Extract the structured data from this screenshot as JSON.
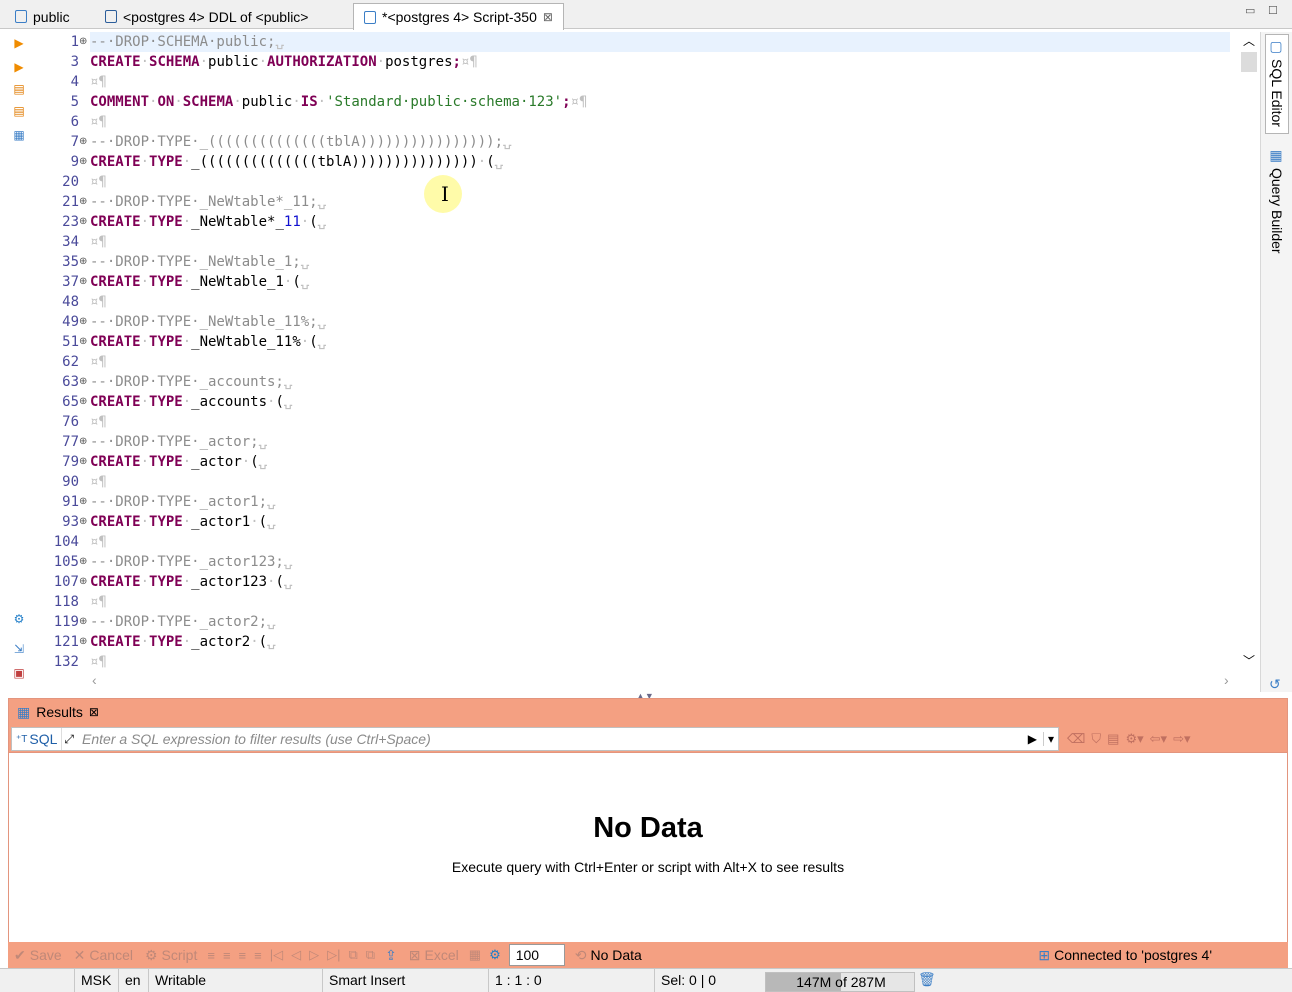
{
  "tabs": [
    {
      "label": "public",
      "icon": "schema-icon",
      "active": false
    },
    {
      "label": "<postgres 4> DDL of <public>",
      "icon": "ddl-icon",
      "active": false
    },
    {
      "label": "*<postgres 4> Script-350",
      "icon": "script-icon",
      "active": true
    }
  ],
  "editor": {
    "lines": [
      {
        "n": "1",
        "fold": "⊕",
        "code": [
          {
            "t": "cm",
            "v": "--·DROP·SCHEMA·public;"
          },
          {
            "t": "ws",
            "v": "⍽"
          }
        ]
      },
      {
        "n": "3",
        "fold": "",
        "code": [
          {
            "t": "kw",
            "v": "CREATE"
          },
          {
            "t": "ws",
            "v": "·"
          },
          {
            "t": "kw",
            "v": "SCHEMA"
          },
          {
            "t": "ws",
            "v": "·"
          },
          {
            "t": "tx",
            "v": "public"
          },
          {
            "t": "ws",
            "v": "·"
          },
          {
            "t": "kw",
            "v": "AUTHORIZATION"
          },
          {
            "t": "ws",
            "v": "·"
          },
          {
            "t": "tx",
            "v": "postgres"
          },
          {
            "t": "kw",
            "v": ";"
          },
          {
            "t": "ws",
            "v": "¤¶"
          }
        ]
      },
      {
        "n": "4",
        "fold": "",
        "code": [
          {
            "t": "ws",
            "v": "¤¶"
          }
        ]
      },
      {
        "n": "5",
        "fold": "",
        "code": [
          {
            "t": "kw",
            "v": "COMMENT"
          },
          {
            "t": "ws",
            "v": "·"
          },
          {
            "t": "kw",
            "v": "ON"
          },
          {
            "t": "ws",
            "v": "·"
          },
          {
            "t": "kw",
            "v": "SCHEMA"
          },
          {
            "t": "ws",
            "v": "·"
          },
          {
            "t": "tx",
            "v": "public"
          },
          {
            "t": "ws",
            "v": "·"
          },
          {
            "t": "kw",
            "v": "IS"
          },
          {
            "t": "ws",
            "v": "·"
          },
          {
            "t": "str",
            "v": "'Standard·public·schema·123'"
          },
          {
            "t": "kw",
            "v": ";"
          },
          {
            "t": "ws",
            "v": "¤¶"
          }
        ]
      },
      {
        "n": "6",
        "fold": "",
        "code": [
          {
            "t": "ws",
            "v": "¤¶"
          }
        ]
      },
      {
        "n": "7",
        "fold": "⊕",
        "code": [
          {
            "t": "cm",
            "v": "--·DROP·TYPE·_((((((((((((((tblA))))))))))))))));"
          },
          {
            "t": "ws",
            "v": "⍽"
          }
        ]
      },
      {
        "n": "9",
        "fold": "⊕",
        "code": [
          {
            "t": "kw",
            "v": "CREATE"
          },
          {
            "t": "ws",
            "v": "·"
          },
          {
            "t": "kw",
            "v": "TYPE"
          },
          {
            "t": "ws",
            "v": "·"
          },
          {
            "t": "tx",
            "v": "_((((((((((((((tblA)))))))))))))))"
          },
          {
            "t": "ws",
            "v": "·"
          },
          {
            "t": "tx",
            "v": "("
          },
          {
            "t": "ws",
            "v": "⍽"
          }
        ]
      },
      {
        "n": "20",
        "fold": "",
        "code": [
          {
            "t": "ws",
            "v": "¤¶"
          }
        ]
      },
      {
        "n": "21",
        "fold": "⊕",
        "code": [
          {
            "t": "cm",
            "v": "--·DROP·TYPE·_NeWtable*_11;"
          },
          {
            "t": "ws",
            "v": "⍽"
          }
        ]
      },
      {
        "n": "23",
        "fold": "⊕",
        "code": [
          {
            "t": "kw",
            "v": "CREATE"
          },
          {
            "t": "ws",
            "v": "·"
          },
          {
            "t": "kw",
            "v": "TYPE"
          },
          {
            "t": "ws",
            "v": "·"
          },
          {
            "t": "tx",
            "v": "_NeWtable*_"
          },
          {
            "t": "num",
            "v": "11"
          },
          {
            "t": "ws",
            "v": "·"
          },
          {
            "t": "tx",
            "v": "("
          },
          {
            "t": "ws",
            "v": "⍽"
          }
        ]
      },
      {
        "n": "34",
        "fold": "",
        "code": [
          {
            "t": "ws",
            "v": "¤¶"
          }
        ]
      },
      {
        "n": "35",
        "fold": "⊕",
        "code": [
          {
            "t": "cm",
            "v": "--·DROP·TYPE·_NeWtable_1;"
          },
          {
            "t": "ws",
            "v": "⍽"
          }
        ]
      },
      {
        "n": "37",
        "fold": "⊕",
        "code": [
          {
            "t": "kw",
            "v": "CREATE"
          },
          {
            "t": "ws",
            "v": "·"
          },
          {
            "t": "kw",
            "v": "TYPE"
          },
          {
            "t": "ws",
            "v": "·"
          },
          {
            "t": "tx",
            "v": "_NeWtable_1"
          },
          {
            "t": "ws",
            "v": "·"
          },
          {
            "t": "tx",
            "v": "("
          },
          {
            "t": "ws",
            "v": "⍽"
          }
        ]
      },
      {
        "n": "48",
        "fold": "",
        "code": [
          {
            "t": "ws",
            "v": "¤¶"
          }
        ]
      },
      {
        "n": "49",
        "fold": "⊕",
        "code": [
          {
            "t": "cm",
            "v": "--·DROP·TYPE·_NeWtable_11%;"
          },
          {
            "t": "ws",
            "v": "⍽"
          }
        ]
      },
      {
        "n": "51",
        "fold": "⊕",
        "code": [
          {
            "t": "kw",
            "v": "CREATE"
          },
          {
            "t": "ws",
            "v": "·"
          },
          {
            "t": "kw",
            "v": "TYPE"
          },
          {
            "t": "ws",
            "v": "·"
          },
          {
            "t": "tx",
            "v": "_NeWtable_11%"
          },
          {
            "t": "ws",
            "v": "·"
          },
          {
            "t": "tx",
            "v": "("
          },
          {
            "t": "ws",
            "v": "⍽"
          }
        ]
      },
      {
        "n": "62",
        "fold": "",
        "code": [
          {
            "t": "ws",
            "v": "¤¶"
          }
        ]
      },
      {
        "n": "63",
        "fold": "⊕",
        "code": [
          {
            "t": "cm",
            "v": "--·DROP·TYPE·_accounts;"
          },
          {
            "t": "ws",
            "v": "⍽"
          }
        ]
      },
      {
        "n": "65",
        "fold": "⊕",
        "code": [
          {
            "t": "kw",
            "v": "CREATE"
          },
          {
            "t": "ws",
            "v": "·"
          },
          {
            "t": "kw",
            "v": "TYPE"
          },
          {
            "t": "ws",
            "v": "·"
          },
          {
            "t": "tx",
            "v": "_accounts"
          },
          {
            "t": "ws",
            "v": "·"
          },
          {
            "t": "tx",
            "v": "("
          },
          {
            "t": "ws",
            "v": "⍽"
          }
        ]
      },
      {
        "n": "76",
        "fold": "",
        "code": [
          {
            "t": "ws",
            "v": "¤¶"
          }
        ]
      },
      {
        "n": "77",
        "fold": "⊕",
        "code": [
          {
            "t": "cm",
            "v": "--·DROP·TYPE·_actor;"
          },
          {
            "t": "ws",
            "v": "⍽"
          }
        ]
      },
      {
        "n": "79",
        "fold": "⊕",
        "code": [
          {
            "t": "kw",
            "v": "CREATE"
          },
          {
            "t": "ws",
            "v": "·"
          },
          {
            "t": "kw",
            "v": "TYPE"
          },
          {
            "t": "ws",
            "v": "·"
          },
          {
            "t": "tx",
            "v": "_actor"
          },
          {
            "t": "ws",
            "v": "·"
          },
          {
            "t": "tx",
            "v": "("
          },
          {
            "t": "ws",
            "v": "⍽"
          }
        ]
      },
      {
        "n": "90",
        "fold": "",
        "code": [
          {
            "t": "ws",
            "v": "¤¶"
          }
        ]
      },
      {
        "n": "91",
        "fold": "⊕",
        "code": [
          {
            "t": "cm",
            "v": "--·DROP·TYPE·_actor1;"
          },
          {
            "t": "ws",
            "v": "⍽"
          }
        ]
      },
      {
        "n": "93",
        "fold": "⊕",
        "code": [
          {
            "t": "kw",
            "v": "CREATE"
          },
          {
            "t": "ws",
            "v": "·"
          },
          {
            "t": "kw",
            "v": "TYPE"
          },
          {
            "t": "ws",
            "v": "·"
          },
          {
            "t": "tx",
            "v": "_actor1"
          },
          {
            "t": "ws",
            "v": "·"
          },
          {
            "t": "tx",
            "v": "("
          },
          {
            "t": "ws",
            "v": "⍽"
          }
        ]
      },
      {
        "n": "104",
        "fold": "",
        "code": [
          {
            "t": "ws",
            "v": "¤¶"
          }
        ]
      },
      {
        "n": "105",
        "fold": "⊕",
        "code": [
          {
            "t": "cm",
            "v": "--·DROP·TYPE·_actor123;"
          },
          {
            "t": "ws",
            "v": "⍽"
          }
        ]
      },
      {
        "n": "107",
        "fold": "⊕",
        "code": [
          {
            "t": "kw",
            "v": "CREATE"
          },
          {
            "t": "ws",
            "v": "·"
          },
          {
            "t": "kw",
            "v": "TYPE"
          },
          {
            "t": "ws",
            "v": "·"
          },
          {
            "t": "tx",
            "v": "_actor123"
          },
          {
            "t": "ws",
            "v": "·"
          },
          {
            "t": "tx",
            "v": "("
          },
          {
            "t": "ws",
            "v": "⍽"
          }
        ]
      },
      {
        "n": "118",
        "fold": "",
        "code": [
          {
            "t": "ws",
            "v": "¤¶"
          }
        ]
      },
      {
        "n": "119",
        "fold": "⊕",
        "code": [
          {
            "t": "cm",
            "v": "--·DROP·TYPE·_actor2;"
          },
          {
            "t": "ws",
            "v": "⍽"
          }
        ]
      },
      {
        "n": "121",
        "fold": "⊕",
        "code": [
          {
            "t": "kw",
            "v": "CREATE"
          },
          {
            "t": "ws",
            "v": "·"
          },
          {
            "t": "kw",
            "v": "TYPE"
          },
          {
            "t": "ws",
            "v": "·"
          },
          {
            "t": "tx",
            "v": "_actor2"
          },
          {
            "t": "ws",
            "v": "·"
          },
          {
            "t": "tx",
            "v": "("
          },
          {
            "t": "ws",
            "v": "⍽"
          }
        ]
      },
      {
        "n": "132",
        "fold": "",
        "code": [
          {
            "t": "ws",
            "v": "¤¶"
          }
        ]
      }
    ]
  },
  "side_tabs": {
    "sql_editor": "SQL Editor",
    "query_builder": "Query Builder"
  },
  "results": {
    "tab_label": "Results",
    "sql_button": "SQL",
    "filter_placeholder": "Enter a SQL expression to filter results (use Ctrl+Space)",
    "no_data_title": "No Data",
    "no_data_hint": "Execute query with Ctrl+Enter or script with Alt+X to see results"
  },
  "toolbar": {
    "save": "Save",
    "cancel": "Cancel",
    "script": "Script",
    "excel": "Excel",
    "limit": "100",
    "row_status": "No Data",
    "connection": "Connected to 'postgres 4'"
  },
  "status": {
    "timezone": "MSK",
    "locale": "en",
    "mode": "Writable",
    "insert_mode": "Smart Insert",
    "position": "1 : 1 : 0",
    "selection": "Sel: 0 | 0",
    "memory": "147M of 287M",
    "memory_used_fraction": 0.51
  },
  "colors": {
    "results_accent": "#f4a082",
    "keyword": "#7f0055",
    "string": "#2a7a2a",
    "comment": "#8c8c8c"
  }
}
